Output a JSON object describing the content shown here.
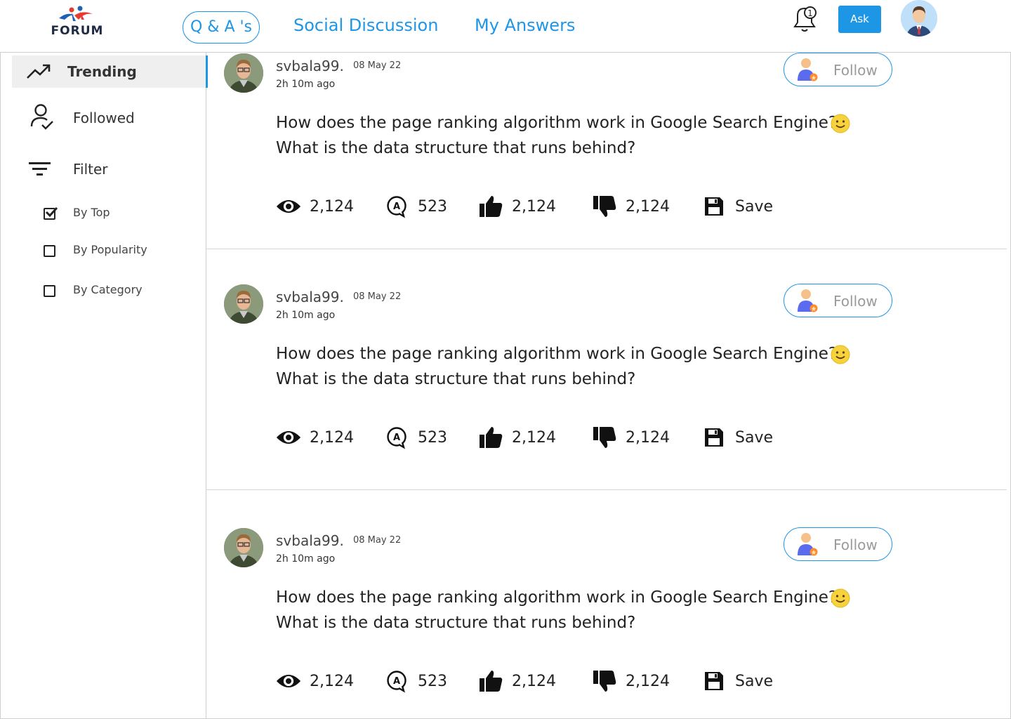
{
  "header": {
    "logo_text": "FORUM",
    "tabs": [
      {
        "label": "Q & A 's",
        "active": true
      },
      {
        "label": "Social Discussion",
        "active": false
      },
      {
        "label": "My Answers",
        "active": false
      }
    ],
    "notification_count": "1",
    "ask_label": "Ask"
  },
  "sidebar": {
    "items": [
      {
        "label": "Trending",
        "icon": "trending-up-icon",
        "active": true
      },
      {
        "label": "Followed",
        "icon": "user-check-icon",
        "active": false
      },
      {
        "label": "Filter",
        "icon": "filter-icon",
        "active": false
      }
    ],
    "filters": [
      {
        "label": "By Top",
        "checked": true
      },
      {
        "label": "By Popularity",
        "checked": false
      },
      {
        "label": "By Category",
        "checked": false
      }
    ]
  },
  "posts": [
    {
      "username": "svbala99.",
      "date": "08 May 22",
      "time_ago": "2h 10m ago",
      "follow_label": "Follow",
      "question_line1": "How does the page ranking algorithm work in Google Search Engine?",
      "question_line2": "What is the data structure that runs behind?",
      "views": "2,124",
      "answers": "523",
      "likes": "2,124",
      "dislikes": "2,124",
      "save_label": "Save"
    },
    {
      "username": "svbala99.",
      "date": "08 May 22",
      "time_ago": "2h 10m ago",
      "follow_label": "Follow",
      "question_line1": "How does the page ranking algorithm work in Google Search Engine?",
      "question_line2": "What is the data structure that runs behind?",
      "views": "2,124",
      "answers": "523",
      "likes": "2,124",
      "dislikes": "2,124",
      "save_label": "Save"
    },
    {
      "username": "svbala99.",
      "date": "08 May 22",
      "time_ago": "2h 10m ago",
      "follow_label": "Follow",
      "question_line1": "How does the page ranking algorithm work in Google Search Engine?",
      "question_line2": "What is the data structure that runs behind?",
      "views": "2,124",
      "answers": "523",
      "likes": "2,124",
      "dislikes": "2,124",
      "save_label": "Save"
    }
  ],
  "colors": {
    "accent": "#1e96e6",
    "sidebar_active_bg": "#efefef",
    "divider": "#d6d6d6"
  }
}
